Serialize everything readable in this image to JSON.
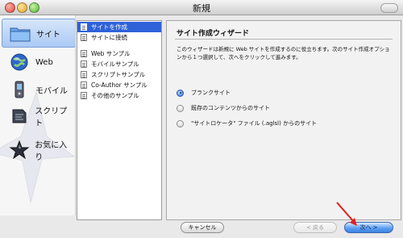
{
  "window": {
    "title": "新規"
  },
  "categories": [
    {
      "label": "サイト",
      "icon": "site-folder-icon",
      "selected": true
    },
    {
      "label": "Web",
      "icon": "globe-icon",
      "selected": false
    },
    {
      "label": "モバイル",
      "icon": "mobile-phone-icon",
      "selected": false
    },
    {
      "label": "スクリプト",
      "icon": "script-icon",
      "selected": false
    },
    {
      "label": "お気に入り",
      "icon": "favorite-star-icon",
      "selected": false
    }
  ],
  "list": {
    "items": [
      {
        "label": "サイトを作成",
        "selected": true
      },
      {
        "label": "サイトに接続",
        "selected": false
      },
      {
        "label": "Web サンプル",
        "selected": false
      },
      {
        "label": "モバイルサンプル",
        "selected": false
      },
      {
        "label": "スクリプトサンプル",
        "selected": false
      },
      {
        "label": "Co-Author サンプル",
        "selected": false
      },
      {
        "label": "その他のサンプル",
        "selected": false
      }
    ]
  },
  "wizard": {
    "title": "サイト作成ウィザード",
    "description": "このウィザードは新規に Web サイトを作成するのに役立ちます。次のサイト作成オプションから１つ選択して、次へをクリックして進みます。",
    "options": [
      {
        "label": "ブランクサイト",
        "selected": true
      },
      {
        "label": "既存のコンテンツからのサイト",
        "selected": false
      },
      {
        "label": "\"サイトロケータ\" ファイル (.aglsl) からのサイト",
        "selected": false
      }
    ]
  },
  "buttons": {
    "cancel": "キャンセル",
    "back": "< 戻る",
    "next": "次へ >"
  },
  "colors": {
    "accent": "#2f62d8",
    "next_button": "#3b84e0",
    "annotation_arrow": "#e0201c"
  }
}
